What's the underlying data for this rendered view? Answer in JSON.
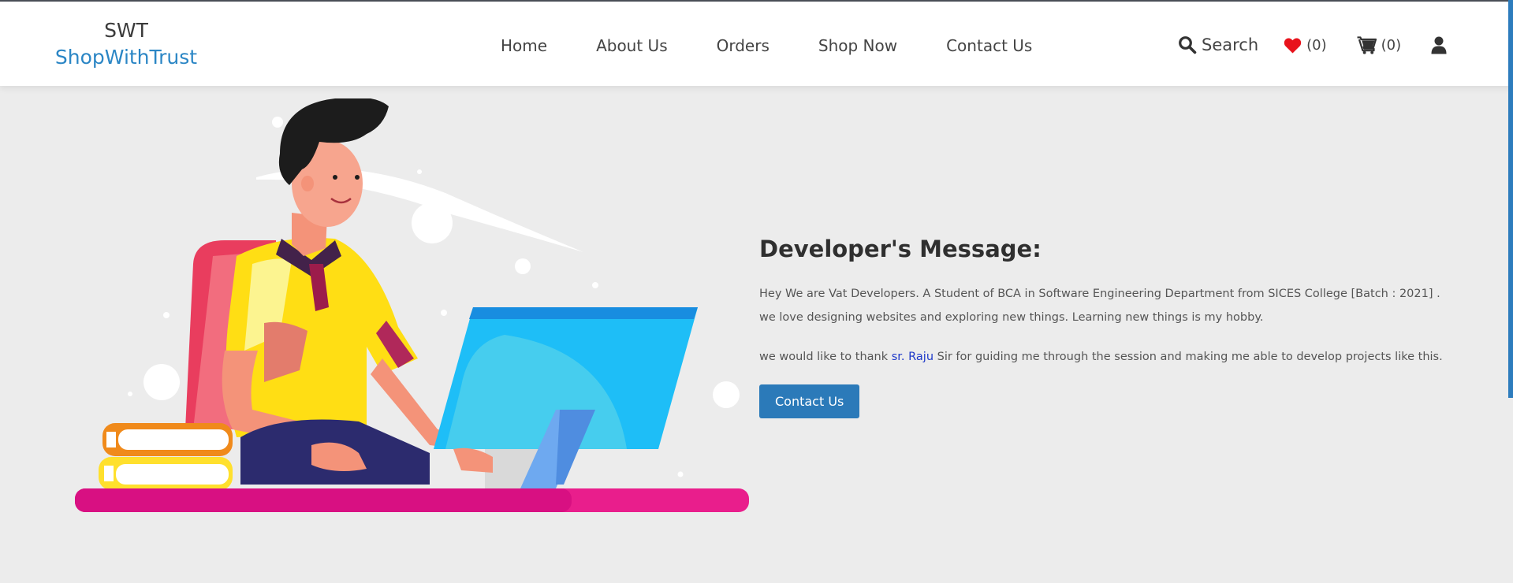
{
  "brand": {
    "short": "SWT",
    "full": "ShopWithTrust"
  },
  "nav": {
    "home": "Home",
    "about": "About Us",
    "orders": "Orders",
    "shop": "Shop Now",
    "contact": "Contact Us"
  },
  "tools": {
    "search_label": "Search",
    "wishlist_count": "(0)",
    "cart_count": "(0)"
  },
  "message": {
    "title": "Developer's Message:",
    "para1": "Hey We are Vat Developers. A Student of BCA in Software Engineering Department from SICES College [Batch : 2021] . we love designing websites and exploring new things. Learning new things is my hobby.",
    "para2_before": "we would like to thank ",
    "para2_highlight": "sr. Raju",
    "para2_after": " Sir for guiding me through the session and making me able to develop projects like this.",
    "button": "Contact Us"
  },
  "colors": {
    "brand_blue": "#2b86c5",
    "heart_red": "#e8121b",
    "button_blue": "#2b7ab9",
    "highlight_blue": "#1d38c9"
  },
  "icons": {
    "search": "search-icon",
    "wishlist": "heart-icon",
    "cart": "cart-icon",
    "account": "user-icon"
  }
}
